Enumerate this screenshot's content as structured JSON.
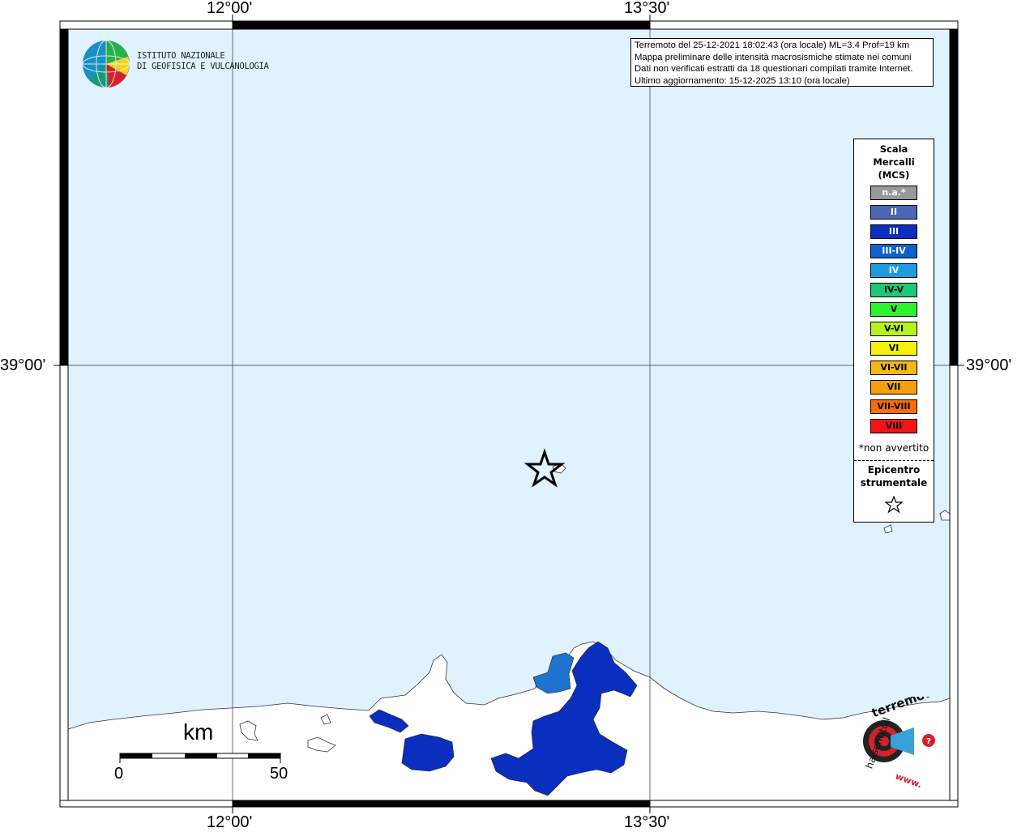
{
  "coords": {
    "top_left": "12°00'",
    "top_right": "13°30'",
    "bottom_left": "12°00'",
    "bottom_right": "13°30'",
    "left": "39°00'",
    "right": "39°00'"
  },
  "logo": {
    "line1": "ISTITUTO NAZIONALE",
    "line2": "DI GEOFISICA E VULCANOLOGIA"
  },
  "info": {
    "line1": "Terremoto del 25-12-2021 18:02:43 (ora locale) ML=3.4 Prof=19 km",
    "line2": "Mappa preliminare delle intensità macrosismiche stimate nei comuni",
    "line3": "Dati non verificati estratti da 18 questionari compilati tramite Internet.",
    "line4": "Ultimo aggiornamento: 15-12-2025 13:10 (ora locale)"
  },
  "legend": {
    "title1": "Scala",
    "title2": "Mercalli",
    "title3": "(MCS)",
    "items": [
      {
        "label": "n.a.*",
        "color": "#999999",
        "text_color": "#ffffff"
      },
      {
        "label": "II",
        "color": "#4d66b3",
        "text_color": "#ffffff"
      },
      {
        "label": "III",
        "color": "#0a2fbf",
        "text_color": "#ffffff"
      },
      {
        "label": "III-IV",
        "color": "#0a63cc",
        "text_color": "#ffffff"
      },
      {
        "label": "IV",
        "color": "#1e9be0",
        "text_color": "#ffffff"
      },
      {
        "label": "IV-V",
        "color": "#1ec878",
        "text_color": "#000000"
      },
      {
        "label": "V",
        "color": "#2df22d",
        "text_color": "#000000"
      },
      {
        "label": "V-VI",
        "color": "#b8f21a",
        "text_color": "#000000"
      },
      {
        "label": "VI",
        "color": "#f5f20a",
        "text_color": "#000000"
      },
      {
        "label": "VI-VII",
        "color": "#f5b814",
        "text_color": "#000000"
      },
      {
        "label": "VII",
        "color": "#f5a00a",
        "text_color": "#000000"
      },
      {
        "label": "VII-VIII",
        "color": "#f56e0a",
        "text_color": "#000000"
      },
      {
        "label": "VIII",
        "color": "#f51414",
        "text_color": "#000000"
      }
    ],
    "note": "*non avvertito",
    "epicentre1": "Epicentro",
    "epicentre2": "strumentale"
  },
  "scalebar": {
    "unit": "km",
    "start": "0",
    "end": "50"
  },
  "brand": {
    "top": "terremoto.it",
    "left": "haisentitoil",
    "bottom": "www."
  },
  "colors": {
    "sea": "#e0f2fe",
    "land": "#ffffff",
    "intensity_III": "#0a2fbf",
    "intensity_IV": "#1e73cc"
  }
}
